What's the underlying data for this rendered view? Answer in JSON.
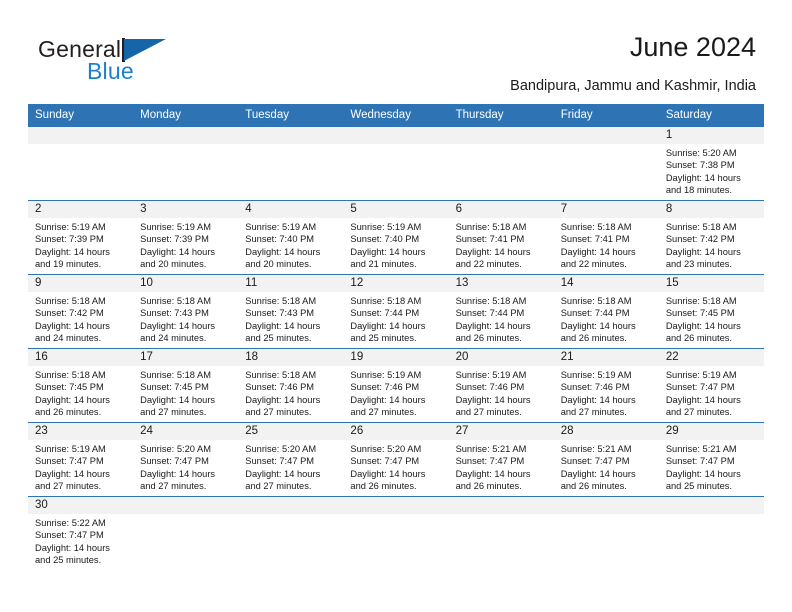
{
  "brand": {
    "name_part1": "General",
    "name_part2": "Blue",
    "accent_color": "#1565a8",
    "text_color": "#231f20"
  },
  "header": {
    "title": "June 2024",
    "subtitle": "Bandipura, Jammu and Kashmir, India"
  },
  "calendar": {
    "header_bg": "#2e74b5",
    "daynum_bg": "#f2f2f2",
    "weekdays": [
      "Sunday",
      "Monday",
      "Tuesday",
      "Wednesday",
      "Thursday",
      "Friday",
      "Saturday"
    ],
    "weeks": [
      [
        {
          "day": "",
          "sunrise": "",
          "sunset": "",
          "daylight1": "",
          "daylight2": ""
        },
        {
          "day": "",
          "sunrise": "",
          "sunset": "",
          "daylight1": "",
          "daylight2": ""
        },
        {
          "day": "",
          "sunrise": "",
          "sunset": "",
          "daylight1": "",
          "daylight2": ""
        },
        {
          "day": "",
          "sunrise": "",
          "sunset": "",
          "daylight1": "",
          "daylight2": ""
        },
        {
          "day": "",
          "sunrise": "",
          "sunset": "",
          "daylight1": "",
          "daylight2": ""
        },
        {
          "day": "",
          "sunrise": "",
          "sunset": "",
          "daylight1": "",
          "daylight2": ""
        },
        {
          "day": "1",
          "sunrise": "Sunrise: 5:20 AM",
          "sunset": "Sunset: 7:38 PM",
          "daylight1": "Daylight: 14 hours",
          "daylight2": "and 18 minutes."
        }
      ],
      [
        {
          "day": "2",
          "sunrise": "Sunrise: 5:19 AM",
          "sunset": "Sunset: 7:39 PM",
          "daylight1": "Daylight: 14 hours",
          "daylight2": "and 19 minutes."
        },
        {
          "day": "3",
          "sunrise": "Sunrise: 5:19 AM",
          "sunset": "Sunset: 7:39 PM",
          "daylight1": "Daylight: 14 hours",
          "daylight2": "and 20 minutes."
        },
        {
          "day": "4",
          "sunrise": "Sunrise: 5:19 AM",
          "sunset": "Sunset: 7:40 PM",
          "daylight1": "Daylight: 14 hours",
          "daylight2": "and 20 minutes."
        },
        {
          "day": "5",
          "sunrise": "Sunrise: 5:19 AM",
          "sunset": "Sunset: 7:40 PM",
          "daylight1": "Daylight: 14 hours",
          "daylight2": "and 21 minutes."
        },
        {
          "day": "6",
          "sunrise": "Sunrise: 5:18 AM",
          "sunset": "Sunset: 7:41 PM",
          "daylight1": "Daylight: 14 hours",
          "daylight2": "and 22 minutes."
        },
        {
          "day": "7",
          "sunrise": "Sunrise: 5:18 AM",
          "sunset": "Sunset: 7:41 PM",
          "daylight1": "Daylight: 14 hours",
          "daylight2": "and 22 minutes."
        },
        {
          "day": "8",
          "sunrise": "Sunrise: 5:18 AM",
          "sunset": "Sunset: 7:42 PM",
          "daylight1": "Daylight: 14 hours",
          "daylight2": "and 23 minutes."
        }
      ],
      [
        {
          "day": "9",
          "sunrise": "Sunrise: 5:18 AM",
          "sunset": "Sunset: 7:42 PM",
          "daylight1": "Daylight: 14 hours",
          "daylight2": "and 24 minutes."
        },
        {
          "day": "10",
          "sunrise": "Sunrise: 5:18 AM",
          "sunset": "Sunset: 7:43 PM",
          "daylight1": "Daylight: 14 hours",
          "daylight2": "and 24 minutes."
        },
        {
          "day": "11",
          "sunrise": "Sunrise: 5:18 AM",
          "sunset": "Sunset: 7:43 PM",
          "daylight1": "Daylight: 14 hours",
          "daylight2": "and 25 minutes."
        },
        {
          "day": "12",
          "sunrise": "Sunrise: 5:18 AM",
          "sunset": "Sunset: 7:44 PM",
          "daylight1": "Daylight: 14 hours",
          "daylight2": "and 25 minutes."
        },
        {
          "day": "13",
          "sunrise": "Sunrise: 5:18 AM",
          "sunset": "Sunset: 7:44 PM",
          "daylight1": "Daylight: 14 hours",
          "daylight2": "and 26 minutes."
        },
        {
          "day": "14",
          "sunrise": "Sunrise: 5:18 AM",
          "sunset": "Sunset: 7:44 PM",
          "daylight1": "Daylight: 14 hours",
          "daylight2": "and 26 minutes."
        },
        {
          "day": "15",
          "sunrise": "Sunrise: 5:18 AM",
          "sunset": "Sunset: 7:45 PM",
          "daylight1": "Daylight: 14 hours",
          "daylight2": "and 26 minutes."
        }
      ],
      [
        {
          "day": "16",
          "sunrise": "Sunrise: 5:18 AM",
          "sunset": "Sunset: 7:45 PM",
          "daylight1": "Daylight: 14 hours",
          "daylight2": "and 26 minutes."
        },
        {
          "day": "17",
          "sunrise": "Sunrise: 5:18 AM",
          "sunset": "Sunset: 7:45 PM",
          "daylight1": "Daylight: 14 hours",
          "daylight2": "and 27 minutes."
        },
        {
          "day": "18",
          "sunrise": "Sunrise: 5:18 AM",
          "sunset": "Sunset: 7:46 PM",
          "daylight1": "Daylight: 14 hours",
          "daylight2": "and 27 minutes."
        },
        {
          "day": "19",
          "sunrise": "Sunrise: 5:19 AM",
          "sunset": "Sunset: 7:46 PM",
          "daylight1": "Daylight: 14 hours",
          "daylight2": "and 27 minutes."
        },
        {
          "day": "20",
          "sunrise": "Sunrise: 5:19 AM",
          "sunset": "Sunset: 7:46 PM",
          "daylight1": "Daylight: 14 hours",
          "daylight2": "and 27 minutes."
        },
        {
          "day": "21",
          "sunrise": "Sunrise: 5:19 AM",
          "sunset": "Sunset: 7:46 PM",
          "daylight1": "Daylight: 14 hours",
          "daylight2": "and 27 minutes."
        },
        {
          "day": "22",
          "sunrise": "Sunrise: 5:19 AM",
          "sunset": "Sunset: 7:47 PM",
          "daylight1": "Daylight: 14 hours",
          "daylight2": "and 27 minutes."
        }
      ],
      [
        {
          "day": "23",
          "sunrise": "Sunrise: 5:19 AM",
          "sunset": "Sunset: 7:47 PM",
          "daylight1": "Daylight: 14 hours",
          "daylight2": "and 27 minutes."
        },
        {
          "day": "24",
          "sunrise": "Sunrise: 5:20 AM",
          "sunset": "Sunset: 7:47 PM",
          "daylight1": "Daylight: 14 hours",
          "daylight2": "and 27 minutes."
        },
        {
          "day": "25",
          "sunrise": "Sunrise: 5:20 AM",
          "sunset": "Sunset: 7:47 PM",
          "daylight1": "Daylight: 14 hours",
          "daylight2": "and 27 minutes."
        },
        {
          "day": "26",
          "sunrise": "Sunrise: 5:20 AM",
          "sunset": "Sunset: 7:47 PM",
          "daylight1": "Daylight: 14 hours",
          "daylight2": "and 26 minutes."
        },
        {
          "day": "27",
          "sunrise": "Sunrise: 5:21 AM",
          "sunset": "Sunset: 7:47 PM",
          "daylight1": "Daylight: 14 hours",
          "daylight2": "and 26 minutes."
        },
        {
          "day": "28",
          "sunrise": "Sunrise: 5:21 AM",
          "sunset": "Sunset: 7:47 PM",
          "daylight1": "Daylight: 14 hours",
          "daylight2": "and 26 minutes."
        },
        {
          "day": "29",
          "sunrise": "Sunrise: 5:21 AM",
          "sunset": "Sunset: 7:47 PM",
          "daylight1": "Daylight: 14 hours",
          "daylight2": "and 25 minutes."
        }
      ],
      [
        {
          "day": "30",
          "sunrise": "Sunrise: 5:22 AM",
          "sunset": "Sunset: 7:47 PM",
          "daylight1": "Daylight: 14 hours",
          "daylight2": "and 25 minutes."
        },
        {
          "day": "",
          "sunrise": "",
          "sunset": "",
          "daylight1": "",
          "daylight2": ""
        },
        {
          "day": "",
          "sunrise": "",
          "sunset": "",
          "daylight1": "",
          "daylight2": ""
        },
        {
          "day": "",
          "sunrise": "",
          "sunset": "",
          "daylight1": "",
          "daylight2": ""
        },
        {
          "day": "",
          "sunrise": "",
          "sunset": "",
          "daylight1": "",
          "daylight2": ""
        },
        {
          "day": "",
          "sunrise": "",
          "sunset": "",
          "daylight1": "",
          "daylight2": ""
        },
        {
          "day": "",
          "sunrise": "",
          "sunset": "",
          "daylight1": "",
          "daylight2": ""
        }
      ]
    ]
  }
}
